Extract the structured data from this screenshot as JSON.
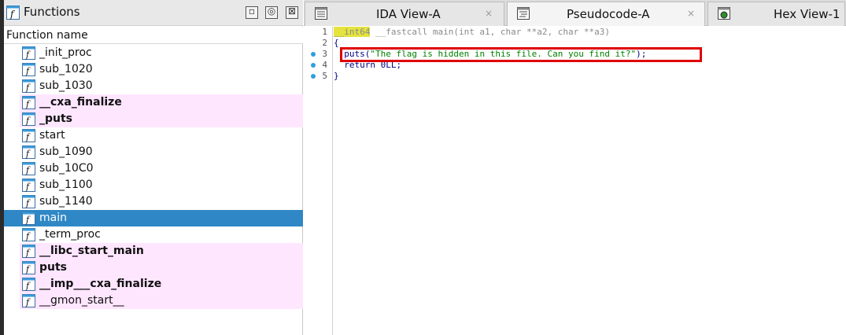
{
  "functions_panel": {
    "title": "Functions",
    "column_header": "Function name",
    "items": [
      {
        "label": "_init_proc",
        "library": false
      },
      {
        "label": "sub_1020",
        "library": false
      },
      {
        "label": "sub_1030",
        "library": false
      },
      {
        "label": "__cxa_finalize",
        "library": true
      },
      {
        "label": "_puts",
        "library": true
      },
      {
        "label": "start",
        "library": false
      },
      {
        "label": "sub_1090",
        "library": false
      },
      {
        "label": "sub_10C0",
        "library": false
      },
      {
        "label": "sub_1100",
        "library": false
      },
      {
        "label": "sub_1140",
        "library": false
      },
      {
        "label": "main",
        "library": false,
        "selected": true
      },
      {
        "label": "_term_proc",
        "library": false
      },
      {
        "label": "__libc_start_main",
        "library": true
      },
      {
        "label": "puts",
        "library": true
      },
      {
        "label": "__imp___cxa_finalize",
        "library": true
      },
      {
        "label": "__gmon_start__",
        "library": false
      }
    ],
    "icons": {
      "function": "function-f-icon",
      "minimize": "minimize-icon",
      "float": "float-icon",
      "close": "close-icon"
    }
  },
  "tabs": [
    {
      "label": "IDA View-A",
      "icon": "ida-view-icon",
      "closable": true
    },
    {
      "label": "Pseudocode-A",
      "icon": "pseudocode-icon",
      "closable": true,
      "active": true
    },
    {
      "label": "Hex View-1",
      "icon": "hex-view-icon",
      "closable": false
    }
  ],
  "tab_close_glyph": "×",
  "code": {
    "line_numbers": [
      "1",
      "2",
      "3",
      "4",
      "5"
    ],
    "line1": {
      "type": "__int64",
      "rest": " __fastcall main(int a1, char **a2, char **a3)"
    },
    "line2": "{",
    "line3": {
      "indent": "  ",
      "fn": "puts(",
      "str": "\"The flag is hidden in this file. Can you find it?\"",
      "end": ");"
    },
    "line4": "  return 0LL;",
    "line5": "}"
  },
  "colors": {
    "selected_row": "#3087c5",
    "library_row": "#ffe6ff",
    "highlight_box": "#e00000",
    "type_highlight": "#e5e33d",
    "string": "#008000",
    "code_keyword": "#00007f",
    "breakpoint_dot": "#2f9fe0"
  }
}
